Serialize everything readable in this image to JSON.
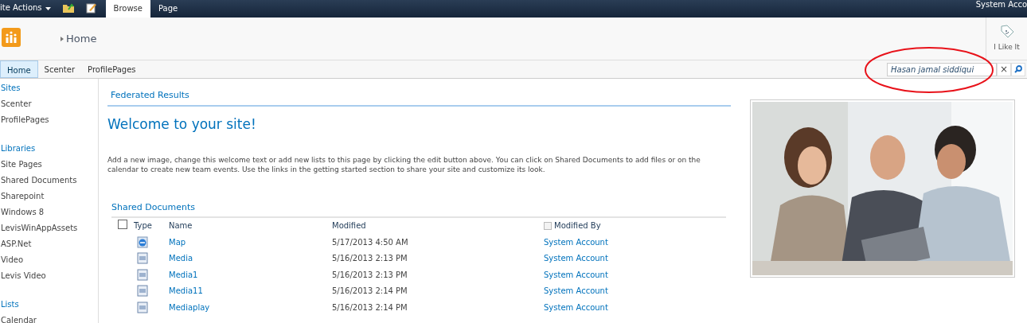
{
  "top_bar": {
    "site_actions": "ite Actions",
    "tabs": [
      {
        "label": "Browse",
        "selected": true
      },
      {
        "label": "Page",
        "selected": false
      }
    ],
    "user": "System Acco"
  },
  "title_area": {
    "breadcrumb": "Home",
    "like_button": "I Like It"
  },
  "nav": {
    "items": [
      {
        "label": "Home",
        "selected": true
      },
      {
        "label": "Scenter",
        "selected": false
      },
      {
        "label": "ProfilePages",
        "selected": false
      }
    ]
  },
  "search": {
    "value": "Hasan jamal siddiqui",
    "clear": "×"
  },
  "highlight_circle": {
    "color": "#e8121a"
  },
  "sidebar": {
    "sections": [
      {
        "heading": "Sites",
        "items": [
          "Scenter",
          "ProfilePages"
        ]
      },
      {
        "heading": "Libraries",
        "items": [
          "Site Pages",
          "Shared Documents",
          "Sharepoint",
          "Windows 8",
          "LevisWinAppAssets",
          "ASP.Net",
          "Video",
          "Levis Video"
        ]
      },
      {
        "heading": "Lists",
        "items": [
          "Calendar"
        ]
      }
    ]
  },
  "federated_title": "Federated Results",
  "welcome": {
    "title": "Welcome to your site!",
    "text": "Add a new image, change this welcome text or add new lists to this page by clicking the edit button above. You can click on Shared Documents to add files or on the calendar to create new team events. Use the links in the getting started section to share your site and customize its look."
  },
  "documents": {
    "title": "Shared Documents",
    "columns": [
      "Type",
      "Name",
      "Modified",
      "Modified By"
    ],
    "select_all_checked": false,
    "modified_by_checkbox": {
      "checked": false,
      "disabled": true
    },
    "rows": [
      {
        "kind": "web",
        "name": "Map",
        "modified": "5/17/2013 4:50 AM",
        "modified_by": "System Account"
      },
      {
        "kind": "doc",
        "name": "Media",
        "modified": "5/16/2013 2:13 PM",
        "modified_by": "System Account"
      },
      {
        "kind": "doc",
        "name": "Media1",
        "modified": "5/16/2013 2:13 PM",
        "modified_by": "System Account"
      },
      {
        "kind": "doc",
        "name": "Media11",
        "modified": "5/16/2013 2:14 PM",
        "modified_by": "System Account"
      },
      {
        "kind": "doc",
        "name": "Mediaplay",
        "modified": "5/16/2013 2:14 PM",
        "modified_by": "System Account"
      }
    ]
  }
}
